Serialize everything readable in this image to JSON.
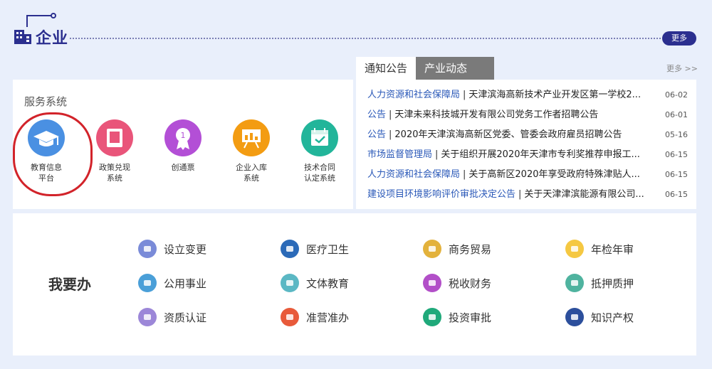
{
  "header": {
    "title": "企业",
    "more_label": "更多",
    "icon": "building-icon",
    "accent": "#2b2f8f"
  },
  "tabs": [
    {
      "label": "通知公告",
      "active": true
    },
    {
      "label": "产业动态",
      "active": false
    }
  ],
  "news_more_label": "更多 >>",
  "services": {
    "title": "服务系统",
    "items": [
      {
        "line1": "教育信息",
        "line2": "平台",
        "icon": "graduation-cap-icon",
        "color": "#4a90e2"
      },
      {
        "line1": "政策兑现",
        "line2": "系统",
        "icon": "book-icon",
        "color": "#e9557a"
      },
      {
        "line1": "创通票",
        "line2": "",
        "icon": "medal-icon",
        "color": "#b34fd6"
      },
      {
        "line1": "企业入库",
        "line2": "系统",
        "icon": "presentation-board-icon",
        "color": "#f39c12"
      },
      {
        "line1": "技术合同",
        "line2": "认定系统",
        "icon": "calendar-check-icon",
        "color": "#22b59a"
      }
    ]
  },
  "news": [
    {
      "category": "人力资源和社会保障局",
      "text": "天津滨海高新技术产业开发区第一学校2...",
      "date": "06-02"
    },
    {
      "category": "公告",
      "text": "天津未来科技城开发有限公司党务工作者招聘公告",
      "date": "06-01"
    },
    {
      "category": "公告",
      "text": "2020年天津滨海高新区党委、管委会政府雇员招聘公告",
      "date": "05-16"
    },
    {
      "category": "市场监督管理局",
      "text": "关于组织开展2020年天津市专利奖推荐申报工...",
      "date": "06-15"
    },
    {
      "category": "人力资源和社会保障局",
      "text": "关于高新区2020年享受政府特殊津贴人...",
      "date": "06-15"
    },
    {
      "category": "建设项目环境影响评价审批决定公告",
      "text": "关于天津津滨能源有限公司...",
      "date": "06-15"
    }
  ],
  "todo": {
    "title": "我要办",
    "items": [
      {
        "label": "设立变更",
        "icon": "register-icon",
        "color": "#7a8bd8"
      },
      {
        "label": "医疗卫生",
        "icon": "medical-icon",
        "color": "#2b6ab8"
      },
      {
        "label": "商务贸易",
        "icon": "trade-icon",
        "color": "#e3b23c"
      },
      {
        "label": "年检年审",
        "icon": "inspection-icon",
        "color": "#f5c842"
      },
      {
        "label": "公用事业",
        "icon": "utility-icon",
        "color": "#4a9fd8"
      },
      {
        "label": "文体教育",
        "icon": "culture-education-icon",
        "color": "#5bb8c4"
      },
      {
        "label": "税收财务",
        "icon": "tax-finance-icon",
        "color": "#b24fc8"
      },
      {
        "label": "抵押质押",
        "icon": "mortgage-icon",
        "color": "#4fb39f"
      },
      {
        "label": "资质认证",
        "icon": "qualification-icon",
        "color": "#9c87d8"
      },
      {
        "label": "准营准办",
        "icon": "permit-icon",
        "color": "#e85a3a"
      },
      {
        "label": "投资审批",
        "icon": "investment-icon",
        "color": "#1fa97a"
      },
      {
        "label": "知识产权",
        "icon": "ip-icon",
        "color": "#2c4f9c"
      }
    ]
  }
}
